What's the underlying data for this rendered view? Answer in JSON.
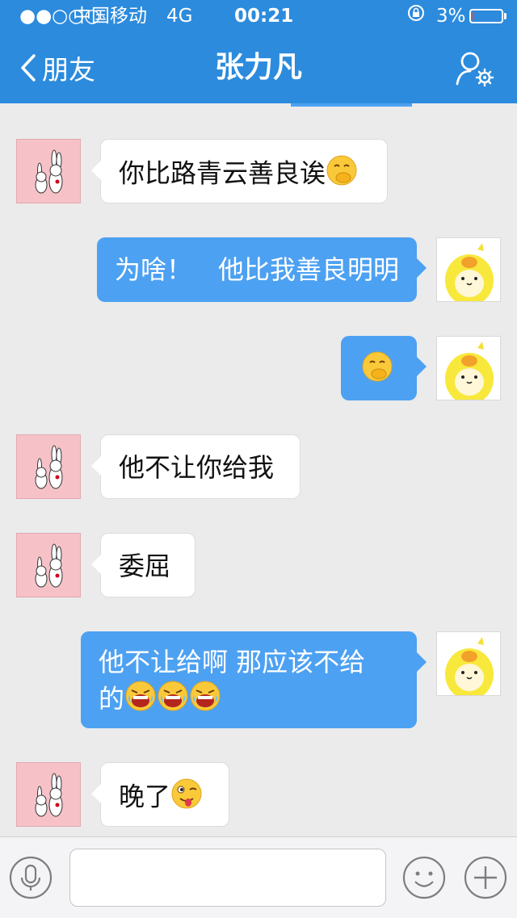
{
  "status_bar": {
    "signal": "●●○○○",
    "carrier": "中国移动",
    "network": "4G",
    "time": "00:21",
    "battery_percent": "3%",
    "battery_level": 0.03
  },
  "nav": {
    "back_label": "朋友",
    "title": "张力凡"
  },
  "messages": [
    {
      "side": "left",
      "text": "你比路青云善良诶",
      "emojis": [
        "cover-mouth"
      ]
    },
    {
      "side": "right",
      "text": "为啥！　他比我善良明明",
      "emojis": []
    },
    {
      "side": "right",
      "text": "",
      "emojis": [
        "cover-mouth"
      ]
    },
    {
      "side": "left",
      "text": "他不让你给我",
      "emojis": []
    },
    {
      "side": "left",
      "text": "委屈",
      "emojis": []
    },
    {
      "side": "right",
      "text_line1": "他不让给啊  那应该不给",
      "text_line2": "的",
      "emojis": [
        "crying-laugh",
        "crying-laugh",
        "crying-laugh"
      ]
    },
    {
      "side": "left",
      "text": "晚了",
      "emojis": [
        "tongue-wink"
      ]
    }
  ],
  "input": {
    "value": "",
    "placeholder": ""
  },
  "colors": {
    "header": "#2c8bdc",
    "outgoing_bubble": "#4da1f2",
    "incoming_bubble": "#ffffff",
    "background": "#ebebeb"
  },
  "icons": [
    "chevron-left-icon",
    "profile-settings-icon",
    "microphone-icon",
    "smiley-icon",
    "plus-icon"
  ]
}
